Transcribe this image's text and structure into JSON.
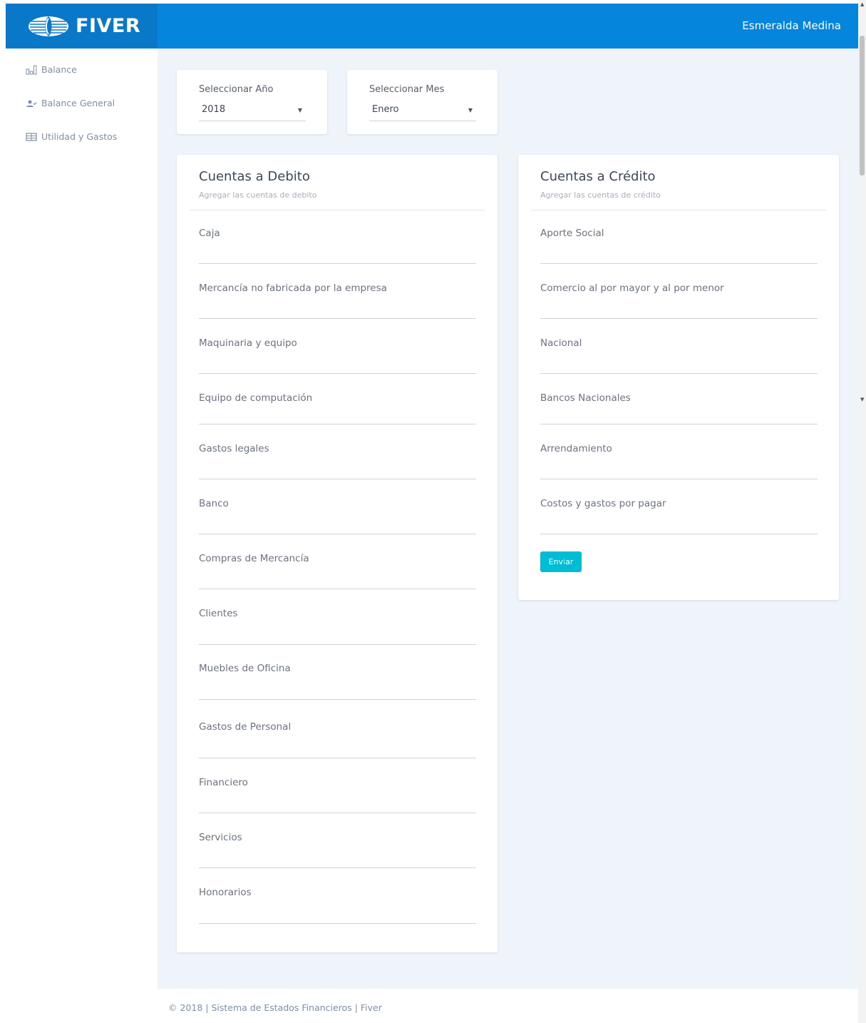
{
  "header": {
    "logo_text": "FIVER",
    "user_name": "Esmeralda Medina"
  },
  "sidebar": {
    "items": [
      {
        "label": "Balance",
        "icon": "bar-chart-icon"
      },
      {
        "label": "Balance General",
        "icon": "user-check-icon"
      },
      {
        "label": "Utilidad y Gastos",
        "icon": "table-icon"
      }
    ]
  },
  "filters": {
    "year": {
      "label": "Seleccionar Año",
      "value": "2018"
    },
    "month": {
      "label": "Seleccionar Mes",
      "value": "Enero"
    }
  },
  "debit": {
    "title": "Cuentas a Debito",
    "subtitle": "Agregar las cuentas de debito",
    "fields": [
      "Caja",
      "Mercancía no fabricada por la empresa",
      "Maquinaria y equipo",
      "Equipo de computación",
      "Gastos legales",
      "Banco",
      "Compras de Mercancía",
      "Clientes",
      "Muebles de Oficina",
      "Gastos de Personal",
      "Financiero",
      "Servicios",
      "Honorarios"
    ]
  },
  "credit": {
    "title": "Cuentas a Crédito",
    "subtitle": "Agregar las cuentas de crédito",
    "fields": [
      "Aporte Social",
      "Comercio al por mayor y al por menor",
      "Nacional",
      "Bancos Nacionales",
      "Arrendamiento",
      "Costos y gastos por pagar"
    ],
    "submit_label": "Enviar"
  },
  "footer": {
    "text": "© 2018 | Sistema de Estados Financieros | Fiver"
  },
  "colors": {
    "header": "#0586dc",
    "accent_button": "#00bcd4",
    "content_bg": "#eef4f9"
  }
}
